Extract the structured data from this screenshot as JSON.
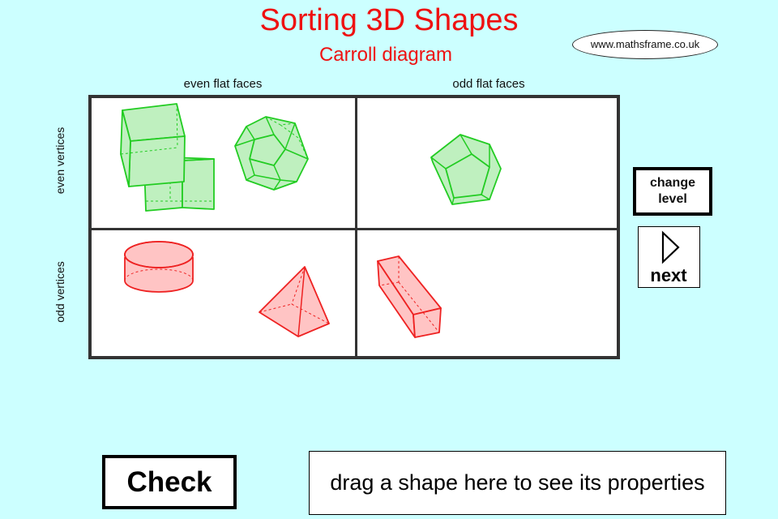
{
  "header": {
    "title": "Sorting 3D Shapes",
    "subtitle": "Carroll diagram",
    "website": "www.mathsframe.co.uk"
  },
  "diagram": {
    "columns": [
      "even flat faces",
      "odd flat faces"
    ],
    "rows": [
      "even vertices",
      "odd vertices"
    ],
    "shapes": [
      {
        "name": "cube",
        "cell": "even vertices / even flat faces",
        "color": "#22cc22"
      },
      {
        "name": "cuboid",
        "cell": "even vertices / even flat faces",
        "color": "#22cc22"
      },
      {
        "name": "dodecahedron",
        "cell": "even vertices / even flat faces",
        "color": "#22cc22"
      },
      {
        "name": "pentagonal-solid",
        "cell": "even vertices / odd flat faces",
        "color": "#22cc22"
      },
      {
        "name": "cylinder",
        "cell": "odd vertices / even flat faces",
        "color": "#ee2222"
      },
      {
        "name": "square-based-pyramid",
        "cell": "odd vertices / even flat faces",
        "color": "#ee2222"
      },
      {
        "name": "square-prism",
        "cell": "odd vertices / odd flat faces",
        "color": "#ee2222"
      }
    ]
  },
  "controls": {
    "change_level": "change\nlevel",
    "next": "next",
    "check": "Check"
  },
  "info_box": {
    "text": "drag a shape here to see its properties"
  },
  "colors": {
    "background": "#ccffff",
    "title": "#ee1111",
    "correct_shape": "#22cc22",
    "wrong_shape": "#ee2222"
  }
}
